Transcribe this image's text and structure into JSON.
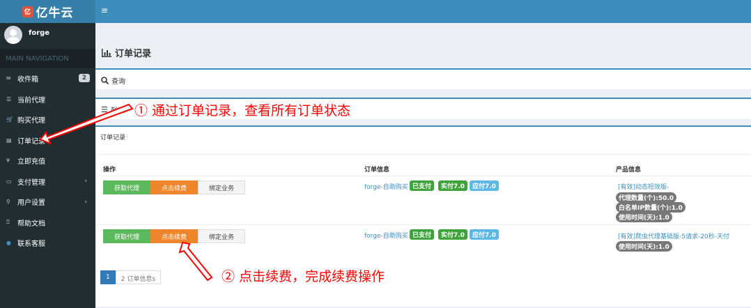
{
  "app": {
    "logo_mark": "亿",
    "logo_text": "亿牛云",
    "menu_glyph": "≡"
  },
  "user": {
    "name": "forge"
  },
  "nav": {
    "header": "MAIN NAVIGATION",
    "items": [
      {
        "label": "收件箱",
        "icon": "✉",
        "badge": "2"
      },
      {
        "label": "当前代理",
        "icon": "☰"
      },
      {
        "label": "购买代理",
        "icon": "🛒"
      },
      {
        "label": "订单记录",
        "icon": "▤"
      },
      {
        "label": "立即充值",
        "icon": "¥"
      },
      {
        "label": "支付管理",
        "icon": "▭",
        "chevron": "‹"
      },
      {
        "label": "用户设置",
        "icon": "⚲",
        "chevron": "‹"
      },
      {
        "label": "帮助文档",
        "icon": "⍰"
      },
      {
        "label": "联系客服",
        "icon": "●"
      }
    ]
  },
  "page": {
    "title": "订单记录"
  },
  "search": {
    "label": "查询"
  },
  "list": {
    "label": "列表"
  },
  "table": {
    "title": "订单记录",
    "headers": [
      "操作",
      "订单信息",
      "产品信息"
    ],
    "rows": [
      {
        "buttons": [
          "获取代理",
          "点击续费",
          "绑定业务"
        ],
        "order": "forge-自助购买",
        "tags": [
          "已支付",
          "实付7.0",
          "应付7.0"
        ],
        "product_link": "[有效]动态短效版-",
        "product_tags": [
          "代理数量(个):50.0",
          "白名单IP数量(个):1.0",
          "使用时间(天):1.0"
        ]
      },
      {
        "buttons": [
          "获取代理",
          "点击续费",
          "绑定业务"
        ],
        "order": "forge-自助购买",
        "tags": [
          "已支付",
          "实付7.0",
          "应付7.0"
        ],
        "product_link": "[有效]爬虫代理基础版-5请求-20秒-天付",
        "product_tags": [
          "使用时间(天):1.0"
        ]
      }
    ]
  },
  "pager": {
    "current": "1",
    "info": "2 订单信息s"
  },
  "annotations": {
    "note1": "① 通过订单记录，查看所有订单状态",
    "note2": "② 点击续费，完成续费操作",
    "color": "#ff0000"
  }
}
